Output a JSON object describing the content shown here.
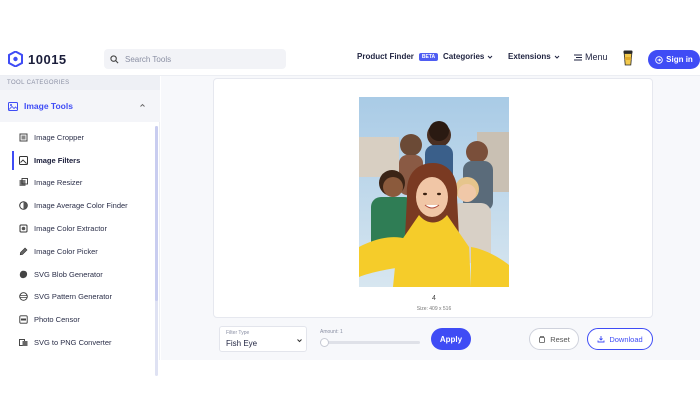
{
  "header": {
    "logo_text": "10015",
    "search_placeholder": "Search Tools",
    "nav": {
      "product_finder": "Product Finder",
      "beta_badge": "BETA",
      "categories": "Categories",
      "extensions": "Extensions",
      "menu": "Menu"
    },
    "signin_label": "Sign in"
  },
  "sidebar": {
    "section_title": "TOOL CATEGORIES",
    "category_label": "Image Tools",
    "items": [
      {
        "label": "Image Cropper",
        "icon": "crop-icon"
      },
      {
        "label": "Image Filters",
        "icon": "filter-icon",
        "active": true
      },
      {
        "label": "Image Resizer",
        "icon": "resize-icon"
      },
      {
        "label": "Image Average Color Finder",
        "icon": "color-circle-icon"
      },
      {
        "label": "Image Color Extractor",
        "icon": "color-extract-icon"
      },
      {
        "label": "Image Color Picker",
        "icon": "color-picker-icon"
      },
      {
        "label": "SVG Blob Generator",
        "icon": "blob-icon"
      },
      {
        "label": "SVG Pattern Generator",
        "icon": "pattern-icon"
      },
      {
        "label": "Photo Censor",
        "icon": "censor-icon"
      },
      {
        "label": "SVG to PNG Converter",
        "icon": "convert-icon"
      }
    ]
  },
  "main": {
    "image_index": "4",
    "image_size": "Size: 409 x 516",
    "filter_type_label": "Filter Type",
    "filter_type_value": "Fish Eye",
    "amount_label": "Amount: 1",
    "amount_level": 0.0,
    "apply_label": "Apply",
    "reset_label": "Reset",
    "download_label": "Download"
  },
  "colors": {
    "accent": "#3f4cf5",
    "text": "#1f2340"
  }
}
